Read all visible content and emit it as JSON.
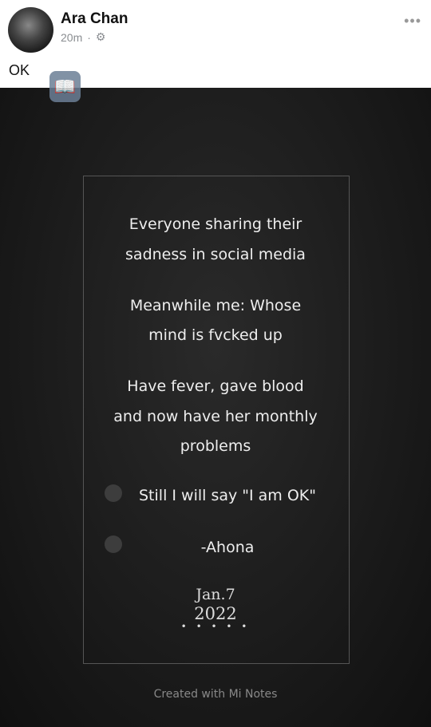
{
  "post": {
    "author": "Ara Chan",
    "time": "20m",
    "separator": "·",
    "privacy_icon": "gear-icon",
    "more": "•••",
    "text": "OK"
  },
  "note": {
    "lines": [
      "Everyone sharing their",
      "sadness in social media",
      "Meanwhile me: Whose",
      "mind is fvcked up",
      "Have fever, gave blood",
      "and now have her monthly",
      "problems",
      "Still I will say \"I am OK\"",
      "-Ahona"
    ],
    "date_line1": "Jan.7",
    "date_line2": "2022",
    "dots": "• • • • •",
    "footer": "Created with Mi Notes"
  }
}
